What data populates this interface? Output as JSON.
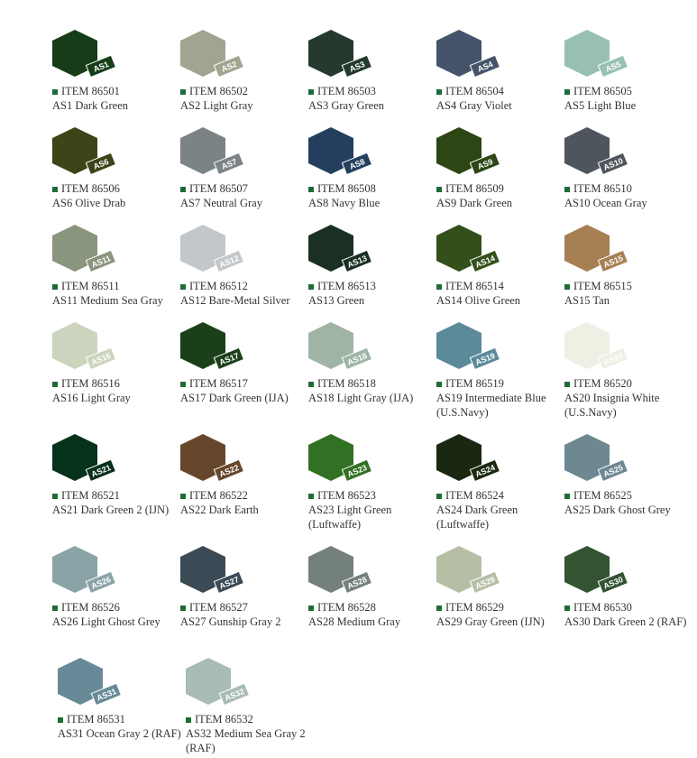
{
  "swatches": [
    {
      "code": "AS1",
      "item": "ITEM 86501",
      "name": "AS1 Dark Green",
      "color": "#163d18"
    },
    {
      "code": "AS2",
      "item": "ITEM 86502",
      "name": "AS2 Light Gray",
      "color": "#a0a590"
    },
    {
      "code": "AS3",
      "item": "ITEM 86503",
      "name": "AS3 Gray Green",
      "color": "#243a2e"
    },
    {
      "code": "AS4",
      "item": "ITEM 86504",
      "name": "AS4 Gray Violet",
      "color": "#45546a"
    },
    {
      "code": "AS5",
      "item": "ITEM 86505",
      "name": "AS5 Light Blue",
      "color": "#97c0b3"
    },
    {
      "code": "AS6",
      "item": "ITEM 86506",
      "name": "AS6 Olive Drab",
      "color": "#3d4417"
    },
    {
      "code": "AS7",
      "item": "ITEM 86507",
      "name": "AS7 Neutral Gray",
      "color": "#7b8387"
    },
    {
      "code": "AS8",
      "item": "ITEM 86508",
      "name": "AS8 Navy Blue",
      "color": "#243f5e"
    },
    {
      "code": "AS9",
      "item": "ITEM 86509",
      "name": "AS9 Dark Green",
      "color": "#2c4614"
    },
    {
      "code": "AS10",
      "item": "ITEM 86510",
      "name": "AS10 Ocean Gray",
      "color": "#4f555c"
    },
    {
      "code": "AS11",
      "item": "ITEM 86511",
      "name": "AS11 Medium Sea Gray",
      "color": "#8a957e"
    },
    {
      "code": "AS12",
      "item": "ITEM 86512",
      "name": "AS12 Bare-Metal Silver",
      "color": "#c3c7ca"
    },
    {
      "code": "AS13",
      "item": "ITEM 86513",
      "name": "AS13 Green",
      "color": "#1b3025"
    },
    {
      "code": "AS14",
      "item": "ITEM 86514",
      "name": "AS14 Olive Green",
      "color": "#34501a"
    },
    {
      "code": "AS15",
      "item": "ITEM 86515",
      "name": "AS15 Tan",
      "color": "#a68052"
    },
    {
      "code": "AS16",
      "item": "ITEM 86516",
      "name": "AS16 Light Gray",
      "color": "#ccd4bd"
    },
    {
      "code": "AS17",
      "item": "ITEM 86517",
      "name": "AS17 Dark Green (IJA)",
      "color": "#1b4019"
    },
    {
      "code": "AS18",
      "item": "ITEM 86518",
      "name": "AS18 Light Gray (IJA)",
      "color": "#9fb4a5"
    },
    {
      "code": "AS19",
      "item": "ITEM 86519",
      "name": "AS19 Intermediate Blue (U.S.Navy)",
      "color": "#5d8a99"
    },
    {
      "code": "AS20",
      "item": "ITEM 86520",
      "name": "AS20 Insignia White (U.S.Navy)",
      "color": "#eef0e3"
    },
    {
      "code": "AS21",
      "item": "ITEM 86521",
      "name": "AS21 Dark Green 2 (IJN)",
      "color": "#06311a"
    },
    {
      "code": "AS22",
      "item": "ITEM 86522",
      "name": "AS22 Dark Earth",
      "color": "#67472b"
    },
    {
      "code": "AS23",
      "item": "ITEM 86523",
      "name": "AS23 Light Green (Luftwaffe)",
      "color": "#327024"
    },
    {
      "code": "AS24",
      "item": "ITEM 86524",
      "name": "AS24 Dark Green (Luftwaffe)",
      "color": "#1b2811"
    },
    {
      "code": "AS25",
      "item": "ITEM 86525",
      "name": "AS25 Dark Ghost Grey",
      "color": "#6d8891"
    },
    {
      "code": "AS26",
      "item": "ITEM 86526",
      "name": "AS26 Light Ghost Grey",
      "color": "#8aa3a6"
    },
    {
      "code": "AS27",
      "item": "ITEM 86527",
      "name": "AS27 Gunship Gray 2",
      "color": "#3c4a55"
    },
    {
      "code": "AS28",
      "item": "ITEM 86528",
      "name": "AS28 Medium Gray",
      "color": "#73807e"
    },
    {
      "code": "AS29",
      "item": "ITEM 86529",
      "name": "AS29 Gray Green (IJN)",
      "color": "#b6bfa6"
    },
    {
      "code": "AS30",
      "item": "ITEM 86530",
      "name": "AS30 Dark Green 2 (RAF)",
      "color": "#335333"
    },
    {
      "code": "AS31",
      "item": "ITEM 86531",
      "name": "AS31 Ocean Gray 2 (RAF)",
      "color": "#688a98"
    },
    {
      "code": "AS32",
      "item": "ITEM 86532",
      "name": "AS32 Medium Sea Gray 2 (RAF)",
      "color": "#a9bbb6"
    }
  ],
  "bullet_color": "#1f6a3a"
}
